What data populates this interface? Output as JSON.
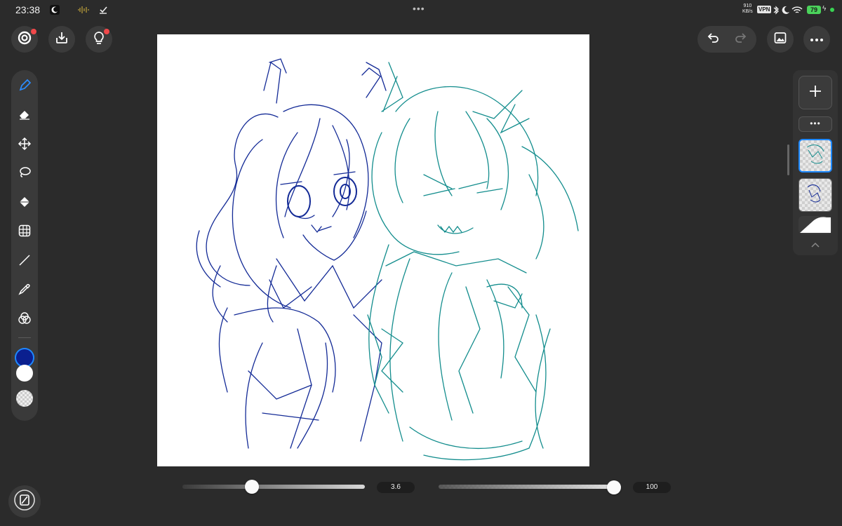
{
  "status_bar": {
    "time": "23:38",
    "menu_dots": "•••",
    "net_speed_value": "910",
    "net_speed_unit": "KB/s",
    "vpn": "VPN",
    "battery": "79",
    "charging": "ϟ"
  },
  "layers": {
    "more_label": "•••"
  },
  "brush": {
    "size_label": "3.6",
    "size_level": 0.37,
    "opacity_label": "100",
    "opacity_level": 1.0
  },
  "colors": {
    "accent": "#1e88ff",
    "primary": "#0a1f8f",
    "secondary": "#ffffff",
    "sketch_blue": "#132a96",
    "sketch_teal": "#138d8d",
    "status_dot": "#39d353",
    "notification_dot": "#f0484a"
  },
  "icons": {
    "app": "brand-icon",
    "export": "export-icon",
    "tips": "lightbulb-icon",
    "undo": "undo-icon",
    "redo": "redo-icon",
    "gallery": "gallery-icon",
    "more": "more-icon",
    "pen": "pen-icon",
    "eraser": "eraser-icon",
    "move": "move-icon",
    "lasso": "lasso-icon",
    "fill": "fill-icon",
    "grid": "grid-icon",
    "line": "line-icon",
    "eyedropper": "eyedropper-icon",
    "blend": "blend-icon",
    "rotate": "rotate-canvas-icon"
  }
}
